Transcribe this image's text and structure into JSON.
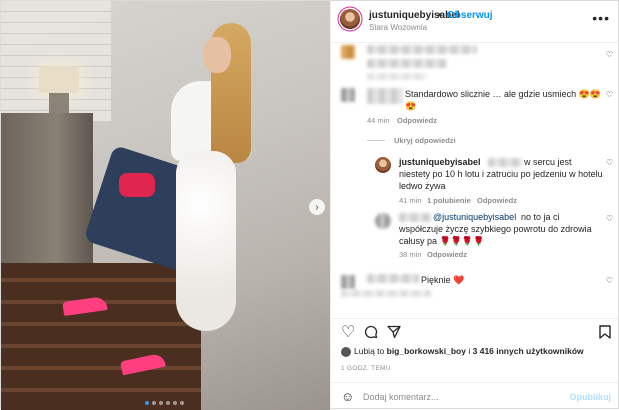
{
  "post": {
    "username": "justuniquebyisabel",
    "separator": "•",
    "follow_label": "Obserwuj",
    "location": "Stara Wozownia",
    "more_icon": "more-horizontal-icon"
  },
  "comments": [
    {
      "text": "",
      "heart_icon": "heart-outline-icon"
    },
    {
      "text": "Standardowo slicznie … ale gdzie usmiech 😍😍😍",
      "time": "44 min",
      "reply_label": "Odpowiedz",
      "heart_icon": "heart-outline-icon",
      "hide_replies_label": "Ukryj odpowiedzi",
      "replies": [
        {
          "username": "justuniquebyisabel",
          "text": "w sercu jest niestety po 10 h lotu i zatruciu po jedzeniu w hotelu ledwo żywa",
          "time": "41 min",
          "likes": "1 polubienie",
          "reply_label": "Odpowiedz",
          "heart_icon": "heart-outline-icon"
        },
        {
          "mention": "@justuniquebyisabel",
          "text": "no to ja ci współczuje życzę szybkiego powrotu do zdrowia całusy pa 🌹🌹🌹🌹",
          "time": "38 min",
          "reply_label": "Odpowiedz",
          "heart_icon": "heart-outline-icon"
        }
      ]
    },
    {
      "text": "Pięknie ❤️",
      "heart_icon": "heart-outline-icon"
    }
  ],
  "actions": {
    "like_icon": "heart-outline-icon",
    "comment_icon": "comment-icon",
    "share_icon": "paper-plane-icon",
    "save_icon": "bookmark-icon"
  },
  "likes": {
    "prefix": "Lubią to",
    "user": "big_borkowski_boy",
    "connector": "i",
    "others": "3 416 innych użytkowników"
  },
  "timestamp": "1 GODZ. TEMU",
  "add_comment": {
    "emoji_icon": "smiley-icon",
    "placeholder": "Dodaj komentarz...",
    "post_label": "Opublikuj"
  },
  "colors": {
    "accent_blue": "#0095f6",
    "post_disabled": "#b2dffc",
    "link_dark": "#00376b",
    "muted": "#8e8e8e",
    "text": "#262626"
  },
  "carousel": {
    "slide_count": 6,
    "active_index": 0,
    "next_icon": "chevron-right-icon"
  }
}
